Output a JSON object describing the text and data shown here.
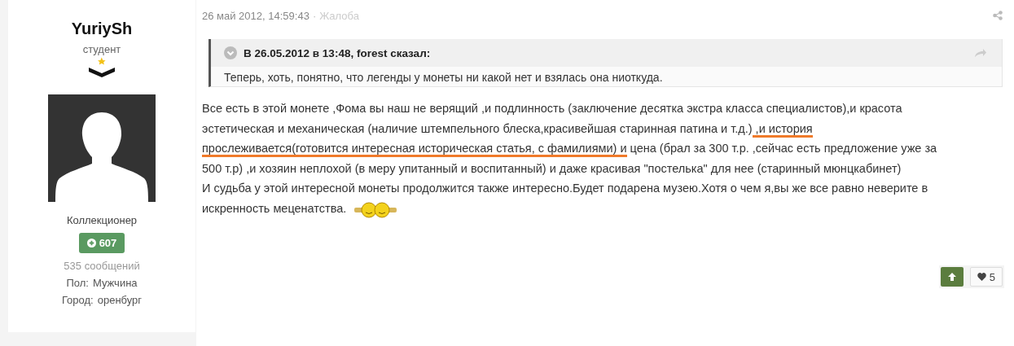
{
  "author": {
    "name": "YuriySh",
    "rank": "студент",
    "avatar": {
      "kind": "silhouette"
    },
    "group": "Коллекционер",
    "reputation": "607",
    "posts": "535 сообщений",
    "fields": [
      {
        "label": "Пол:",
        "value": "Мужчина"
      },
      {
        "label": "Город:",
        "value": "оренбург"
      }
    ]
  },
  "post": {
    "date": "26 май 2012, 14:59:43",
    "separator": "·",
    "report": "Жалоба",
    "quote": {
      "header": "В 26.05.2012 в 13:48, forest сказал:",
      "text": "Теперь, хоть, понятно, что легенды у монеты ни какой нет и взялась она ниоткуда."
    },
    "lines": [
      [
        {
          "text": "Все есть в этой монете ,Фома вы наш не верящий ,и подлинность (заключение десятка экстра класса специалистов),и красота",
          "underlined": false
        }
      ],
      [
        {
          "text": "эстетическая и механическая (наличие штемпельного блеска,красивейшая старинная патина и т.д.)",
          "underlined": false
        },
        {
          "text": " ,и история",
          "underlined": true
        }
      ],
      [
        {
          "text": "прослеживается(готовится интересная историческая статья, с фамилиями) и",
          "underlined": true
        },
        {
          "text": " цена (брал за 300 т.р. ,сейчас есть предложение уже за",
          "underlined": false
        }
      ],
      [
        {
          "text": "500 т.р) ,и хозяин неплохой (в меру упитанный и воспитанный) и даже красивая \"постелька\" для нее (старинный мюнцкабинет)",
          "underlined": false
        }
      ],
      [
        {
          "text": "И судьба у этой интересной монеты продолжится также интересно.Будет подарена музею.Хотя о чем я,вы же все равно неверите в",
          "underlined": false
        }
      ],
      [
        {
          "text": "искренность меценатства.",
          "underlined": false
        }
      ]
    ],
    "likes": "5"
  }
}
